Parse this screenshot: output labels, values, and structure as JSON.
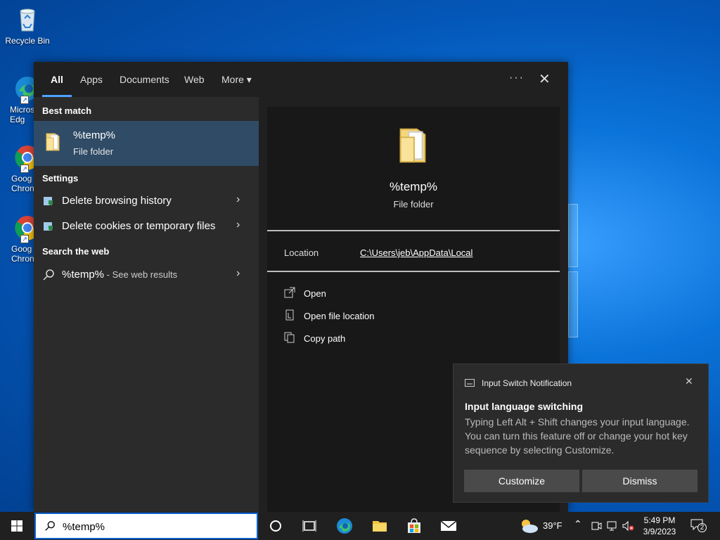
{
  "desktop": {
    "icons": [
      {
        "label": "Recycle Bin"
      },
      {
        "label": "Micros Edg"
      },
      {
        "label": "Goog Chron"
      },
      {
        "label": "Goog Chron"
      }
    ]
  },
  "search_panel": {
    "tabs": [
      "All",
      "Apps",
      "Documents",
      "Web",
      "More"
    ],
    "more_caret": "▾",
    "options_glyph": "···",
    "close_glyph": "✕",
    "best_match": {
      "heading": "Best match",
      "title": "%temp%",
      "subtitle": "File folder"
    },
    "settings": {
      "heading": "Settings",
      "items": [
        "Delete browsing history",
        "Delete cookies or temporary files"
      ]
    },
    "web": {
      "heading": "Search the web",
      "query": "%temp%",
      "suffix": " - See web results"
    },
    "preview": {
      "title": "%temp%",
      "subtitle": "File folder",
      "location_label": "Location",
      "location_value": "C:\\Users\\jeb\\AppData\\Local",
      "actions": [
        "Open",
        "Open file location",
        "Copy path"
      ]
    }
  },
  "notification": {
    "app": "Input Switch Notification",
    "title": "Input language switching",
    "body": "Typing Left Alt + Shift changes your input language. You can turn this feature off or change your hot key sequence by selecting Customize.",
    "buttons": [
      "Customize",
      "Dismiss"
    ]
  },
  "taskbar": {
    "search_text": "%temp%",
    "weather": "39°F",
    "time": "5:49 PM",
    "date": "3/9/2023",
    "notification_count": "2",
    "accent": "#0a62d0"
  }
}
